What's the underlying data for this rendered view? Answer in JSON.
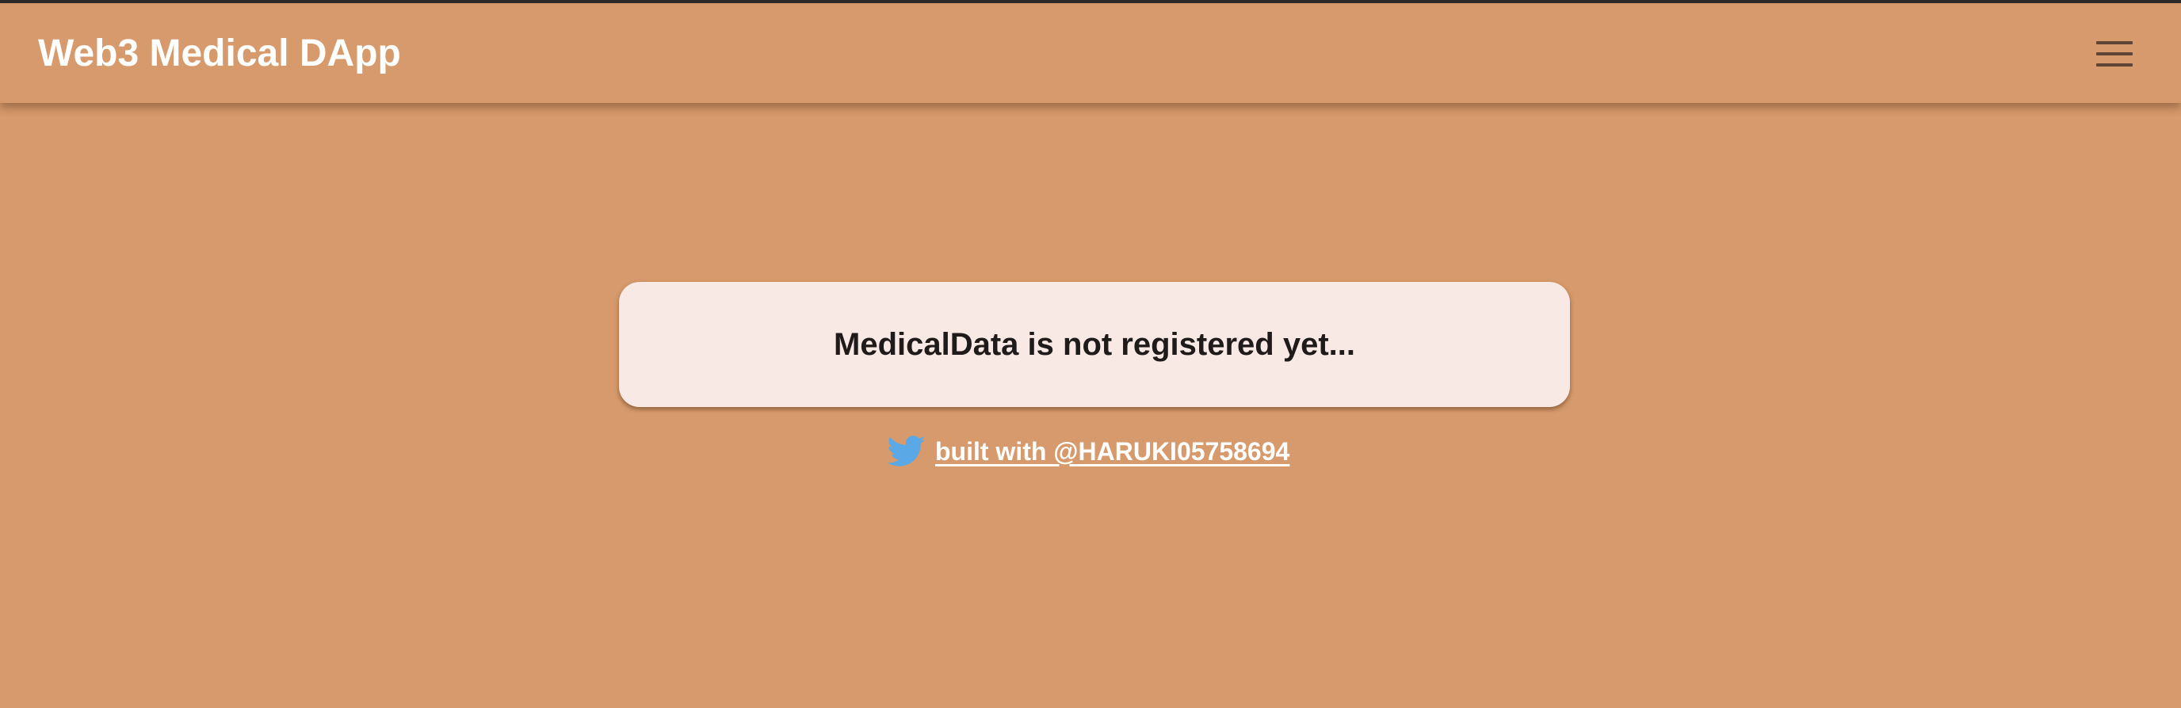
{
  "app_bar": {
    "title": "Web3 Medical DApp",
    "menu_icon": "hamburger-menu-icon"
  },
  "main": {
    "status_message": "MedicalData is not registered yet...",
    "footer": {
      "icon": "twitter-icon",
      "link_text": "built with @HARUKI05758694"
    }
  },
  "colors": {
    "background": "#d79a6c",
    "card": "#f9e9e5",
    "title_text": "#ffffff",
    "card_text": "#1f1b1a",
    "twitter_blue": "#5aa9e6",
    "menu_icon": "#5e4536"
  }
}
